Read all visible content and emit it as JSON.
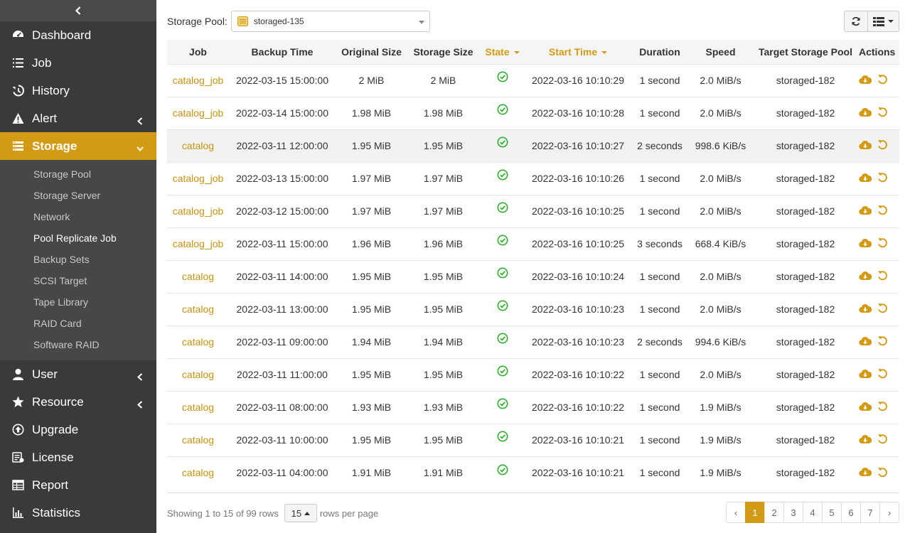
{
  "sidebar": {
    "items_top": [
      {
        "label": "Dashboard",
        "icon": "dashboard-icon"
      },
      {
        "label": "Job",
        "icon": "job-list-icon"
      },
      {
        "label": "History",
        "icon": "history-icon"
      },
      {
        "label": "Alert",
        "icon": "alert-icon",
        "chevron": "left"
      },
      {
        "label": "Storage",
        "icon": "storage-icon",
        "chevron": "down",
        "active": true
      }
    ],
    "storage_sub": [
      "Storage Pool",
      "Storage Server",
      "Network",
      "Pool Replicate Job",
      "Backup Sets",
      "SCSI Target",
      "Tape Library",
      "RAID Card",
      "Software RAID"
    ],
    "storage_sub_current": "Pool Replicate Job",
    "items_bottom": [
      {
        "label": "User",
        "icon": "user-icon",
        "chevron": "left"
      },
      {
        "label": "Resource",
        "icon": "star-icon",
        "chevron": "left"
      },
      {
        "label": "Upgrade",
        "icon": "upgrade-icon"
      },
      {
        "label": "License",
        "icon": "license-icon"
      },
      {
        "label": "Report",
        "icon": "report-icon"
      },
      {
        "label": "Statistics",
        "icon": "statistics-icon"
      }
    ]
  },
  "toolbar": {
    "pool_label": "Storage Pool:",
    "pool_value": "storaged-135"
  },
  "table": {
    "columns": [
      "Job",
      "Backup Time",
      "Original Size",
      "Storage Size",
      "State",
      "Start Time",
      "Duration",
      "Speed",
      "Target Storage Pool",
      "Actions"
    ],
    "rows": [
      [
        "catalog_job",
        "2022-03-15 15:00:00",
        "2 MiB",
        "2 MiB",
        "2022-03-16 10:10:29",
        "1 second",
        "2.0 MiB/s",
        "storaged-182"
      ],
      [
        "catalog_job",
        "2022-03-14 15:00:00",
        "1.98 MiB",
        "1.98 MiB",
        "2022-03-16 10:10:28",
        "1 second",
        "2.0 MiB/s",
        "storaged-182"
      ],
      [
        "catalog",
        "2022-03-11 12:00:00",
        "1.95 MiB",
        "1.95 MiB",
        "2022-03-16 10:10:27",
        "2 seconds",
        "998.6 KiB/s",
        "storaged-182"
      ],
      [
        "catalog_job",
        "2022-03-13 15:00:00",
        "1.97 MiB",
        "1.97 MiB",
        "2022-03-16 10:10:26",
        "1 second",
        "2.0 MiB/s",
        "storaged-182"
      ],
      [
        "catalog_job",
        "2022-03-12 15:00:00",
        "1.97 MiB",
        "1.97 MiB",
        "2022-03-16 10:10:25",
        "1 second",
        "2.0 MiB/s",
        "storaged-182"
      ],
      [
        "catalog_job",
        "2022-03-11 15:00:00",
        "1.96 MiB",
        "1.96 MiB",
        "2022-03-16 10:10:25",
        "3 seconds",
        "668.4 KiB/s",
        "storaged-182"
      ],
      [
        "catalog",
        "2022-03-11 14:00:00",
        "1.95 MiB",
        "1.95 MiB",
        "2022-03-16 10:10:24",
        "1 second",
        "2.0 MiB/s",
        "storaged-182"
      ],
      [
        "catalog",
        "2022-03-11 13:00:00",
        "1.95 MiB",
        "1.95 MiB",
        "2022-03-16 10:10:23",
        "1 second",
        "2.0 MiB/s",
        "storaged-182"
      ],
      [
        "catalog",
        "2022-03-11 09:00:00",
        "1.94 MiB",
        "1.94 MiB",
        "2022-03-16 10:10:23",
        "2 seconds",
        "994.6 KiB/s",
        "storaged-182"
      ],
      [
        "catalog",
        "2022-03-11 11:00:00",
        "1.95 MiB",
        "1.95 MiB",
        "2022-03-16 10:10:22",
        "1 second",
        "2.0 MiB/s",
        "storaged-182"
      ],
      [
        "catalog",
        "2022-03-11 08:00:00",
        "1.93 MiB",
        "1.93 MiB",
        "2022-03-16 10:10:22",
        "1 second",
        "1.9 MiB/s",
        "storaged-182"
      ],
      [
        "catalog",
        "2022-03-11 10:00:00",
        "1.95 MiB",
        "1.95 MiB",
        "2022-03-16 10:10:21",
        "1 second",
        "1.9 MiB/s",
        "storaged-182"
      ],
      [
        "catalog",
        "2022-03-11 04:00:00",
        "1.91 MiB",
        "1.91 MiB",
        "2022-03-16 10:10:21",
        "1 second",
        "1.9 MiB/s",
        "storaged-182"
      ]
    ],
    "state": "success"
  },
  "footer": {
    "showing_text": "Showing 1 to 15 of 99 rows",
    "per_page": "15",
    "per_page_suffix": "rows per page",
    "pages": [
      "‹",
      "1",
      "2",
      "3",
      "4",
      "5",
      "6",
      "7",
      "›"
    ],
    "current_page": "1"
  },
  "colors": {
    "accent": "#d39a13",
    "sidebar_bg": "#3a3a3a",
    "success": "#2eae2e"
  }
}
